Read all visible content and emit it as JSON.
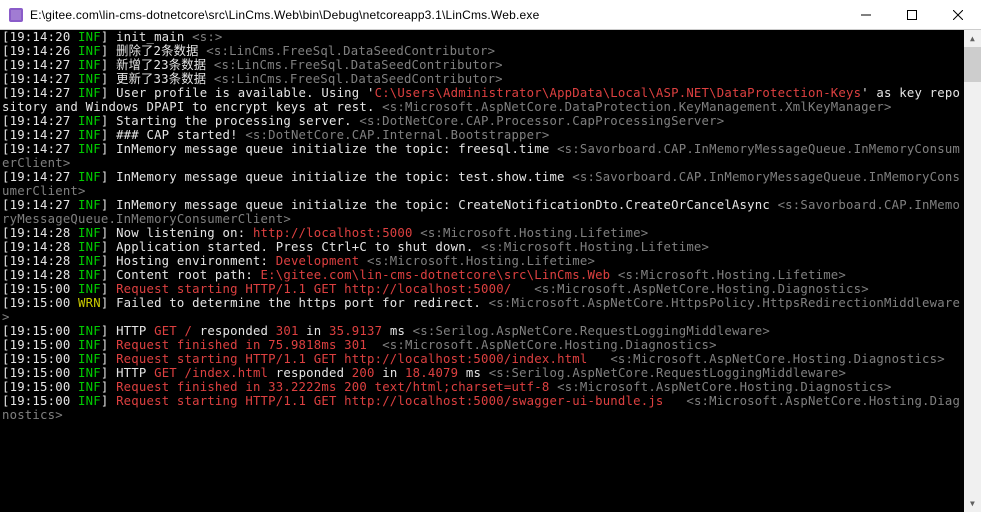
{
  "window": {
    "title": "E:\\gitee.com\\lin-cms-dotnetcore\\src\\LinCms.Web\\bin\\Debug\\netcoreapp3.1\\LinCms.Web.exe"
  },
  "lines": [
    [
      {
        "c": "white",
        "t": "[19:14:20 "
      },
      {
        "c": "green",
        "t": "INF"
      },
      {
        "c": "white",
        "t": "] init_main "
      },
      {
        "c": "gray",
        "t": "<s:>"
      }
    ],
    [
      {
        "c": "white",
        "t": "[19:14:26 "
      },
      {
        "c": "green",
        "t": "INF"
      },
      {
        "c": "white",
        "t": "] 删除了2条数据 "
      },
      {
        "c": "gray",
        "t": "<s:LinCms.FreeSql.DataSeedContributor>"
      }
    ],
    [
      {
        "c": "white",
        "t": "[19:14:27 "
      },
      {
        "c": "green",
        "t": "INF"
      },
      {
        "c": "white",
        "t": "] 新增了23条数据 "
      },
      {
        "c": "gray",
        "t": "<s:LinCms.FreeSql.DataSeedContributor>"
      }
    ],
    [
      {
        "c": "white",
        "t": "[19:14:27 "
      },
      {
        "c": "green",
        "t": "INF"
      },
      {
        "c": "white",
        "t": "] 更新了33条数据 "
      },
      {
        "c": "gray",
        "t": "<s:LinCms.FreeSql.DataSeedContributor>"
      }
    ],
    [
      {
        "c": "white",
        "t": "[19:14:27 "
      },
      {
        "c": "green",
        "t": "INF"
      },
      {
        "c": "white",
        "t": "] User profile is available. Using '"
      },
      {
        "c": "red",
        "t": "C:\\Users\\Administrator\\AppData\\Local\\ASP.NET\\DataProtection-Keys"
      },
      {
        "c": "white",
        "t": "' as key repository and Windows DPAPI to encrypt keys at rest. "
      },
      {
        "c": "gray",
        "t": "<s:Microsoft.AspNetCore.DataProtection.KeyManagement.XmlKeyManager>"
      }
    ],
    [
      {
        "c": "white",
        "t": "[19:14:27 "
      },
      {
        "c": "green",
        "t": "INF"
      },
      {
        "c": "white",
        "t": "] Starting the processing server. "
      },
      {
        "c": "gray",
        "t": "<s:DotNetCore.CAP.Processor.CapProcessingServer>"
      }
    ],
    [
      {
        "c": "white",
        "t": "[19:14:27 "
      },
      {
        "c": "green",
        "t": "INF"
      },
      {
        "c": "white",
        "t": "] ### CAP started! "
      },
      {
        "c": "gray",
        "t": "<s:DotNetCore.CAP.Internal.Bootstrapper>"
      }
    ],
    [
      {
        "c": "white",
        "t": "[19:14:27 "
      },
      {
        "c": "green",
        "t": "INF"
      },
      {
        "c": "white",
        "t": "] InMemory message queue initialize the topic: freesql.time "
      },
      {
        "c": "gray",
        "t": "<s:Savorboard.CAP.InMemoryMessageQueue.InMemoryConsumerClient>"
      }
    ],
    [
      {
        "c": "white",
        "t": "[19:14:27 "
      },
      {
        "c": "green",
        "t": "INF"
      },
      {
        "c": "white",
        "t": "] InMemory message queue initialize the topic: test.show.time "
      },
      {
        "c": "gray",
        "t": "<s:Savorboard.CAP.InMemoryMessageQueue.InMemoryConsumerClient>"
      }
    ],
    [
      {
        "c": "white",
        "t": "[19:14:27 "
      },
      {
        "c": "green",
        "t": "INF"
      },
      {
        "c": "white",
        "t": "] InMemory message queue initialize the topic: CreateNotificationDto.CreateOrCancelAsync "
      },
      {
        "c": "gray",
        "t": "<s:Savorboard.CAP.InMemoryMessageQueue.InMemoryConsumerClient>"
      }
    ],
    [
      {
        "c": "white",
        "t": "[19:14:28 "
      },
      {
        "c": "green",
        "t": "INF"
      },
      {
        "c": "white",
        "t": "] Now listening on: "
      },
      {
        "c": "red",
        "t": "http://localhost:5000"
      },
      {
        "c": "white",
        "t": " "
      },
      {
        "c": "gray",
        "t": "<s:Microsoft.Hosting.Lifetime>"
      }
    ],
    [
      {
        "c": "white",
        "t": "[19:14:28 "
      },
      {
        "c": "green",
        "t": "INF"
      },
      {
        "c": "white",
        "t": "] Application started. Press Ctrl+C to shut down. "
      },
      {
        "c": "gray",
        "t": "<s:Microsoft.Hosting.Lifetime>"
      }
    ],
    [
      {
        "c": "white",
        "t": "[19:14:28 "
      },
      {
        "c": "green",
        "t": "INF"
      },
      {
        "c": "white",
        "t": "] Hosting environment: "
      },
      {
        "c": "red",
        "t": "Development"
      },
      {
        "c": "white",
        "t": " "
      },
      {
        "c": "gray",
        "t": "<s:Microsoft.Hosting.Lifetime>"
      }
    ],
    [
      {
        "c": "white",
        "t": "[19:14:28 "
      },
      {
        "c": "green",
        "t": "INF"
      },
      {
        "c": "white",
        "t": "] Content root path: "
      },
      {
        "c": "red",
        "t": "E:\\gitee.com\\lin-cms-dotnetcore\\src\\LinCms.Web"
      },
      {
        "c": "white",
        "t": " "
      },
      {
        "c": "gray",
        "t": "<s:Microsoft.Hosting.Lifetime>"
      }
    ],
    [
      {
        "c": "white",
        "t": "[19:15:00 "
      },
      {
        "c": "green",
        "t": "INF"
      },
      {
        "c": "white",
        "t": "] "
      },
      {
        "c": "red",
        "t": "Request starting HTTP/1.1 GET http://localhost:5000/  "
      },
      {
        "c": "white",
        "t": " "
      },
      {
        "c": "gray",
        "t": "<s:Microsoft.AspNetCore.Hosting.Diagnostics>"
      }
    ],
    [
      {
        "c": "white",
        "t": "[19:15:00 "
      },
      {
        "c": "yellow",
        "t": "WRN"
      },
      {
        "c": "white",
        "t": "] Failed to determine the https port for redirect. "
      },
      {
        "c": "gray",
        "t": "<s:Microsoft.AspNetCore.HttpsPolicy.HttpsRedirectionMiddleware>"
      }
    ],
    [
      {
        "c": "white",
        "t": "[19:15:00 "
      },
      {
        "c": "green",
        "t": "INF"
      },
      {
        "c": "white",
        "t": "] HTTP "
      },
      {
        "c": "red",
        "t": "GET"
      },
      {
        "c": "white",
        "t": " "
      },
      {
        "c": "red",
        "t": "/"
      },
      {
        "c": "white",
        "t": " responded "
      },
      {
        "c": "red",
        "t": "301"
      },
      {
        "c": "white",
        "t": " in "
      },
      {
        "c": "red",
        "t": "35.9137"
      },
      {
        "c": "white",
        "t": " ms "
      },
      {
        "c": "gray",
        "t": "<s:Serilog.AspNetCore.RequestLoggingMiddleware>"
      }
    ],
    [
      {
        "c": "white",
        "t": "[19:15:00 "
      },
      {
        "c": "green",
        "t": "INF"
      },
      {
        "c": "white",
        "t": "] "
      },
      {
        "c": "red",
        "t": "Request finished in 75.9818ms 301 "
      },
      {
        "c": "white",
        "t": " "
      },
      {
        "c": "gray",
        "t": "<s:Microsoft.AspNetCore.Hosting.Diagnostics>"
      }
    ],
    [
      {
        "c": "white",
        "t": "[19:15:00 "
      },
      {
        "c": "green",
        "t": "INF"
      },
      {
        "c": "white",
        "t": "] "
      },
      {
        "c": "red",
        "t": "Request starting HTTP/1.1 GET http://localhost:5000/index.html  "
      },
      {
        "c": "white",
        "t": " "
      },
      {
        "c": "gray",
        "t": "<s:Microsoft.AspNetCore.Hosting.Diagnostics>"
      }
    ],
    [
      {
        "c": "white",
        "t": "[19:15:00 "
      },
      {
        "c": "green",
        "t": "INF"
      },
      {
        "c": "white",
        "t": "] HTTP "
      },
      {
        "c": "red",
        "t": "GET"
      },
      {
        "c": "white",
        "t": " "
      },
      {
        "c": "red",
        "t": "/index.html"
      },
      {
        "c": "white",
        "t": " responded "
      },
      {
        "c": "red",
        "t": "200"
      },
      {
        "c": "white",
        "t": " in "
      },
      {
        "c": "red",
        "t": "18.4079"
      },
      {
        "c": "white",
        "t": " ms "
      },
      {
        "c": "gray",
        "t": "<s:Serilog.AspNetCore.RequestLoggingMiddleware>"
      }
    ],
    [
      {
        "c": "white",
        "t": "[19:15:00 "
      },
      {
        "c": "green",
        "t": "INF"
      },
      {
        "c": "white",
        "t": "] "
      },
      {
        "c": "red",
        "t": "Request finished in 33.2222ms 200 text/html;charset=utf-8"
      },
      {
        "c": "white",
        "t": " "
      },
      {
        "c": "gray",
        "t": "<s:Microsoft.AspNetCore.Hosting.Diagnostics>"
      }
    ],
    [
      {
        "c": "white",
        "t": "[19:15:00 "
      },
      {
        "c": "green",
        "t": "INF"
      },
      {
        "c": "white",
        "t": "] "
      },
      {
        "c": "red",
        "t": "Request starting HTTP/1.1 GET http://localhost:5000/swagger-ui-bundle.js  "
      },
      {
        "c": "white",
        "t": " "
      },
      {
        "c": "gray",
        "t": "<s:Microsoft.AspNetCore.Hosting.Diagnostics>"
      }
    ]
  ]
}
